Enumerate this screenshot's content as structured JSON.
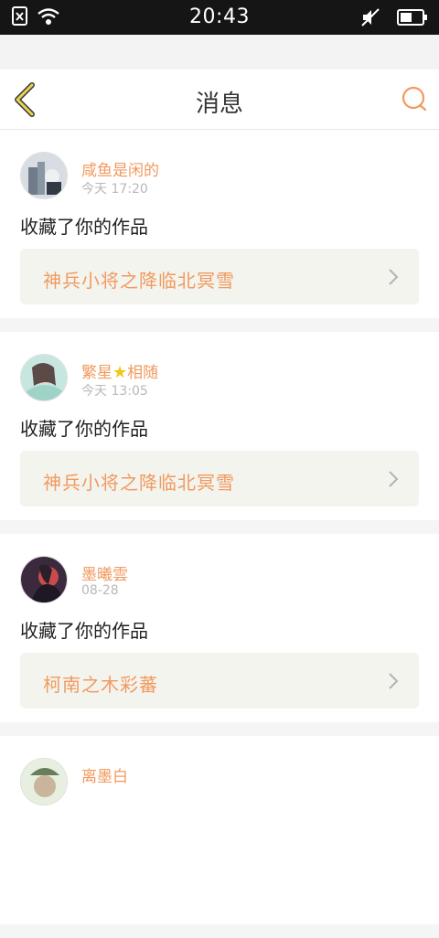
{
  "status_bar": {
    "time": "20:43",
    "icons": [
      "sim-blocked-icon",
      "wifi-icon",
      "mute-icon",
      "battery-icon"
    ]
  },
  "header": {
    "title": "消息",
    "back_icon": "chevron-left-icon",
    "search_icon": "search-icon",
    "accent_color": "#f19a5f"
  },
  "messages": [
    {
      "user": "咸鱼是闲的",
      "time": "今天 17:20",
      "action": "收藏了你的作品",
      "work_title": "神兵小将之降临北冥雪"
    },
    {
      "user_prefix": "繁星",
      "user_suffix": "相随",
      "time": "今天 13:05",
      "action": "收藏了你的作品",
      "work_title": "神兵小将之降临北冥雪"
    },
    {
      "user": "墨曦雲",
      "time": "08-28",
      "action": "收藏了你的作品",
      "work_title": "柯南之木彩蕃"
    },
    {
      "user": "离墨白"
    }
  ]
}
